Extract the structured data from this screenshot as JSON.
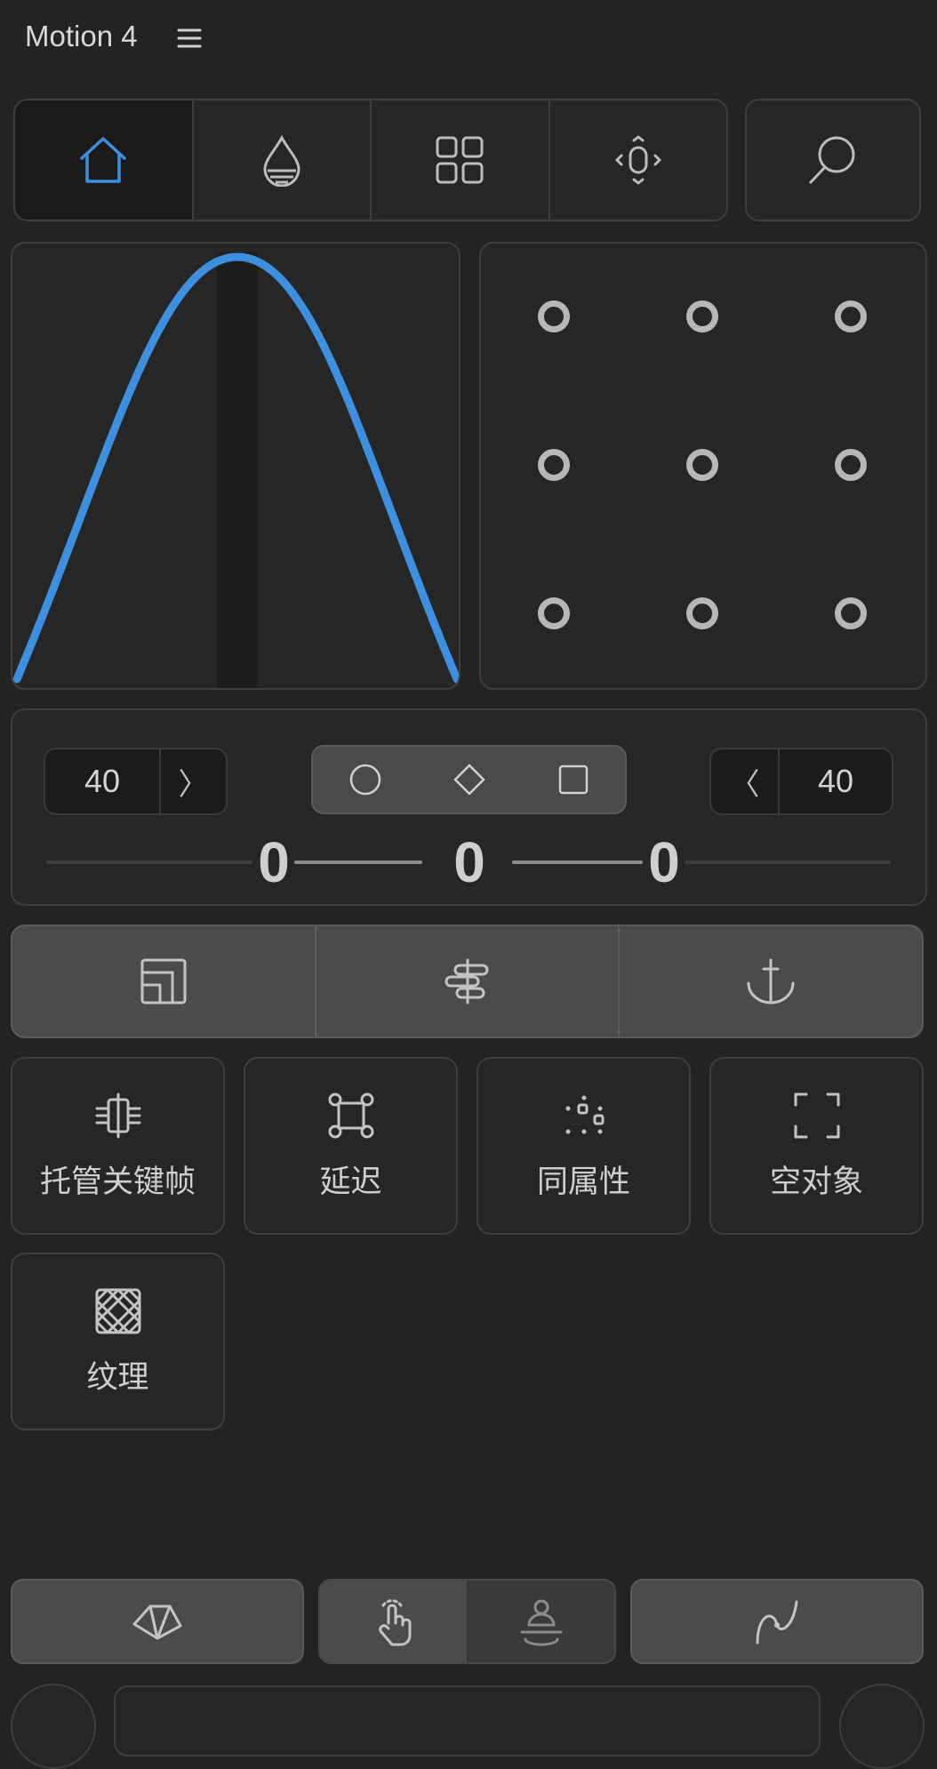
{
  "header": {
    "title": "Motion 4",
    "menu_icon": "hamburger-icon"
  },
  "nav": {
    "tabs": [
      {
        "icon": "home-icon",
        "active": true
      },
      {
        "icon": "drop-icon",
        "active": false
      },
      {
        "icon": "grid-icon",
        "active": false
      },
      {
        "icon": "anchor-adjust-icon",
        "active": false
      }
    ],
    "search_icon": "search-icon",
    "accent": "#3d8fe0"
  },
  "easing": {
    "curve_color": "#3d8fe0"
  },
  "anchor_grid": {
    "rows": 3,
    "cols": 3
  },
  "params": {
    "left_value": "40",
    "left_arrow": "〉",
    "right_value": "40",
    "right_arrow": "〈",
    "shapes": [
      "circle-shape-icon",
      "diamond-shape-icon",
      "square-shape-icon"
    ],
    "handles": [
      "0",
      "0",
      "0"
    ]
  },
  "tools": [
    "layer-stack-icon",
    "align-center-icon",
    "anchor-icon"
  ],
  "features": [
    {
      "label": "托管关键帧",
      "icon": "keyframe-manage-icon"
    },
    {
      "label": "延迟",
      "icon": "delay-icon"
    },
    {
      "label": "同属性",
      "icon": "same-attr-icon"
    },
    {
      "label": "空对象",
      "icon": "null-object-icon"
    },
    {
      "label": "纹理",
      "icon": "texture-icon"
    }
  ],
  "bottom": {
    "left_icon": "fan-icon",
    "toggle": [
      "tap-icon",
      "figure-icon"
    ],
    "right_icon": "path-curve-icon"
  }
}
